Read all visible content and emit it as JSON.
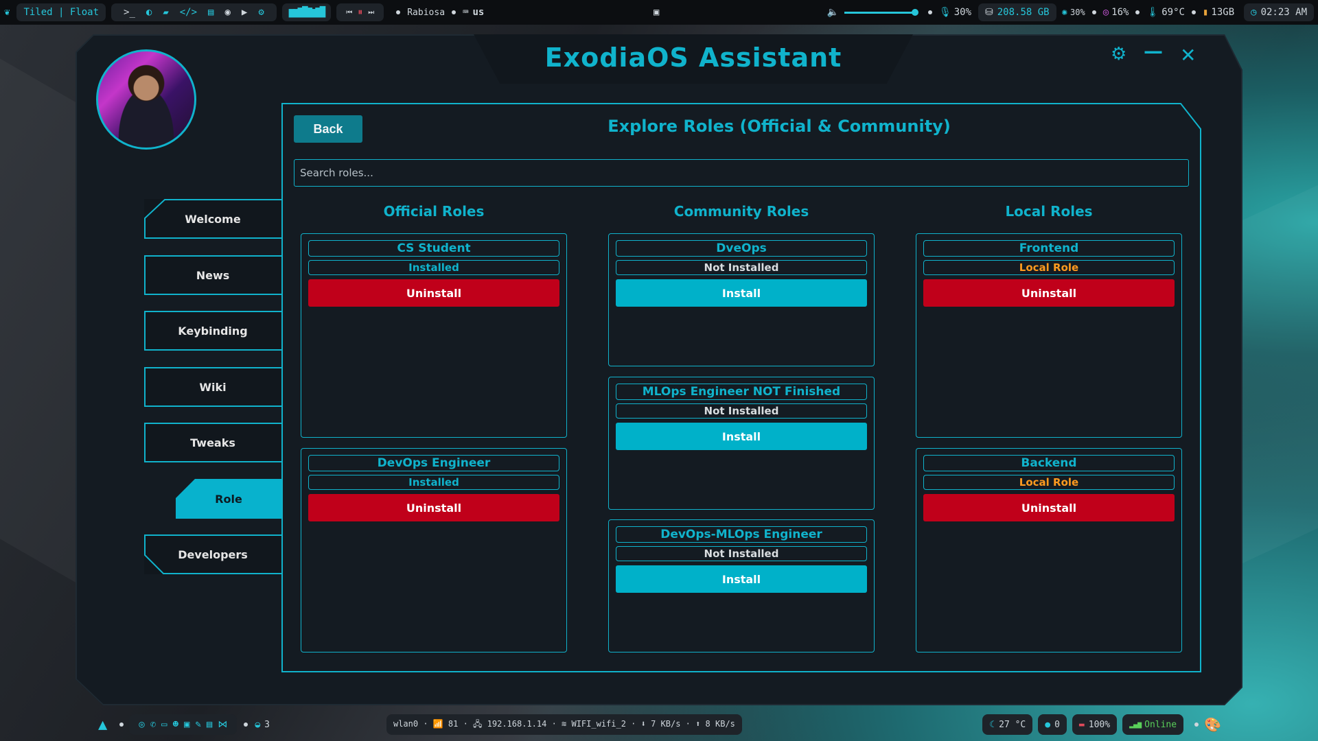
{
  "topbar": {
    "layout_mode": "Tiled | Float",
    "media_user": "Rabiosa",
    "keyboard_layout": "us",
    "volume": "30%",
    "volume_level": 0.8,
    "disk": "208.58 GB",
    "cpu": "30%",
    "gpu": "16%",
    "temp": "69°C",
    "ram": "13GB",
    "clock": "02:23 AM"
  },
  "bottombar": {
    "workspace_count": "3",
    "network": "wlan0 · 📶 81 · 🖧 192.168.1.14 · ≋ WIFI_wifi_2 · ⬇ 7 KB/s · ⬆ 8 KB/s",
    "weather": "27 °C",
    "github": "0",
    "battery": "100%",
    "status": "Online"
  },
  "window": {
    "title": "ExodiaOS Assistant"
  },
  "sidebar": {
    "items": [
      {
        "label": "Welcome"
      },
      {
        "label": "News"
      },
      {
        "label": "Keybinding"
      },
      {
        "label": "Wiki"
      },
      {
        "label": "Tweaks"
      },
      {
        "label": "Role"
      },
      {
        "label": "Developers"
      }
    ]
  },
  "panel": {
    "back_label": "Back",
    "title": "Explore Roles (Official & Community)",
    "search_placeholder": "Search roles...",
    "columns": [
      {
        "title": "Official Roles"
      },
      {
        "title": "Community Roles"
      },
      {
        "title": "Local Roles"
      }
    ],
    "official": [
      {
        "name": "CS Student",
        "status": "Installed",
        "action": "Uninstall"
      },
      {
        "name": "DevOps Engineer",
        "status": "Installed",
        "action": "Uninstall"
      }
    ],
    "community": [
      {
        "name": "DveOps",
        "status": "Not Installed",
        "action": "Install"
      },
      {
        "name": "MLOps Engineer NOT Finished",
        "status": "Not Installed",
        "action": "Install"
      },
      {
        "name": "DevOps-MLOps Engineer",
        "status": "Not Installed",
        "action": "Install"
      }
    ],
    "local": [
      {
        "name": "Frontend",
        "status": "Local Role",
        "action": "Uninstall"
      },
      {
        "name": "Backend",
        "status": "Local Role",
        "action": "Uninstall"
      }
    ]
  },
  "colors": {
    "accent": "#10b3cc",
    "install": "#00b1c9",
    "uninstall": "#c0001a",
    "local_role": "#ff9a1f",
    "window_bg": "#141b22"
  }
}
